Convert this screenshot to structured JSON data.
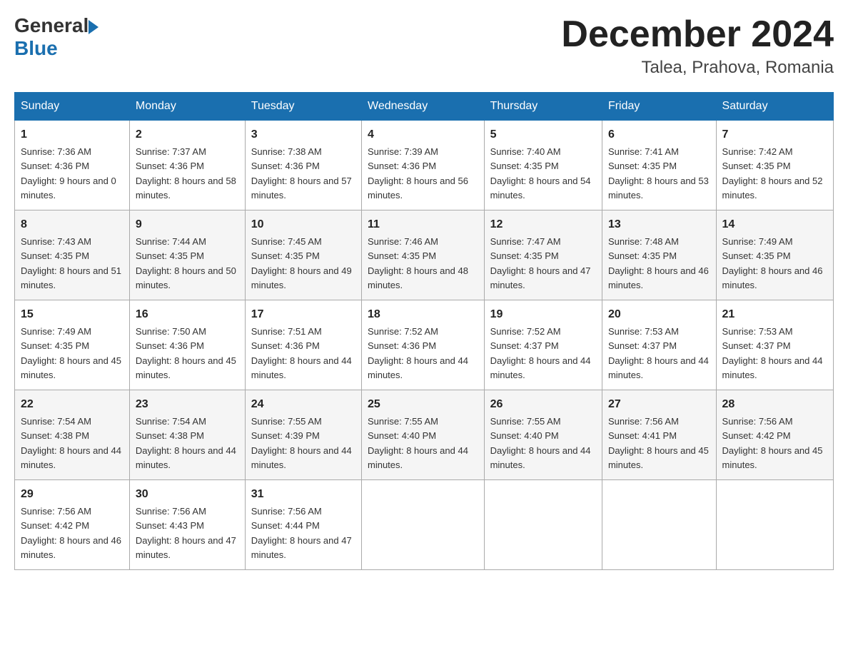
{
  "header": {
    "logo_general": "General",
    "logo_blue": "Blue",
    "month_title": "December 2024",
    "location": "Talea, Prahova, Romania"
  },
  "days_of_week": [
    "Sunday",
    "Monday",
    "Tuesday",
    "Wednesday",
    "Thursday",
    "Friday",
    "Saturday"
  ],
  "weeks": [
    [
      {
        "day": "1",
        "sunrise": "7:36 AM",
        "sunset": "4:36 PM",
        "daylight": "9 hours and 0 minutes."
      },
      {
        "day": "2",
        "sunrise": "7:37 AM",
        "sunset": "4:36 PM",
        "daylight": "8 hours and 58 minutes."
      },
      {
        "day": "3",
        "sunrise": "7:38 AM",
        "sunset": "4:36 PM",
        "daylight": "8 hours and 57 minutes."
      },
      {
        "day": "4",
        "sunrise": "7:39 AM",
        "sunset": "4:36 PM",
        "daylight": "8 hours and 56 minutes."
      },
      {
        "day": "5",
        "sunrise": "7:40 AM",
        "sunset": "4:35 PM",
        "daylight": "8 hours and 54 minutes."
      },
      {
        "day": "6",
        "sunrise": "7:41 AM",
        "sunset": "4:35 PM",
        "daylight": "8 hours and 53 minutes."
      },
      {
        "day": "7",
        "sunrise": "7:42 AM",
        "sunset": "4:35 PM",
        "daylight": "8 hours and 52 minutes."
      }
    ],
    [
      {
        "day": "8",
        "sunrise": "7:43 AM",
        "sunset": "4:35 PM",
        "daylight": "8 hours and 51 minutes."
      },
      {
        "day": "9",
        "sunrise": "7:44 AM",
        "sunset": "4:35 PM",
        "daylight": "8 hours and 50 minutes."
      },
      {
        "day": "10",
        "sunrise": "7:45 AM",
        "sunset": "4:35 PM",
        "daylight": "8 hours and 49 minutes."
      },
      {
        "day": "11",
        "sunrise": "7:46 AM",
        "sunset": "4:35 PM",
        "daylight": "8 hours and 48 minutes."
      },
      {
        "day": "12",
        "sunrise": "7:47 AM",
        "sunset": "4:35 PM",
        "daylight": "8 hours and 47 minutes."
      },
      {
        "day": "13",
        "sunrise": "7:48 AM",
        "sunset": "4:35 PM",
        "daylight": "8 hours and 46 minutes."
      },
      {
        "day": "14",
        "sunrise": "7:49 AM",
        "sunset": "4:35 PM",
        "daylight": "8 hours and 46 minutes."
      }
    ],
    [
      {
        "day": "15",
        "sunrise": "7:49 AM",
        "sunset": "4:35 PM",
        "daylight": "8 hours and 45 minutes."
      },
      {
        "day": "16",
        "sunrise": "7:50 AM",
        "sunset": "4:36 PM",
        "daylight": "8 hours and 45 minutes."
      },
      {
        "day": "17",
        "sunrise": "7:51 AM",
        "sunset": "4:36 PM",
        "daylight": "8 hours and 44 minutes."
      },
      {
        "day": "18",
        "sunrise": "7:52 AM",
        "sunset": "4:36 PM",
        "daylight": "8 hours and 44 minutes."
      },
      {
        "day": "19",
        "sunrise": "7:52 AM",
        "sunset": "4:37 PM",
        "daylight": "8 hours and 44 minutes."
      },
      {
        "day": "20",
        "sunrise": "7:53 AM",
        "sunset": "4:37 PM",
        "daylight": "8 hours and 44 minutes."
      },
      {
        "day": "21",
        "sunrise": "7:53 AM",
        "sunset": "4:37 PM",
        "daylight": "8 hours and 44 minutes."
      }
    ],
    [
      {
        "day": "22",
        "sunrise": "7:54 AM",
        "sunset": "4:38 PM",
        "daylight": "8 hours and 44 minutes."
      },
      {
        "day": "23",
        "sunrise": "7:54 AM",
        "sunset": "4:38 PM",
        "daylight": "8 hours and 44 minutes."
      },
      {
        "day": "24",
        "sunrise": "7:55 AM",
        "sunset": "4:39 PM",
        "daylight": "8 hours and 44 minutes."
      },
      {
        "day": "25",
        "sunrise": "7:55 AM",
        "sunset": "4:40 PM",
        "daylight": "8 hours and 44 minutes."
      },
      {
        "day": "26",
        "sunrise": "7:55 AM",
        "sunset": "4:40 PM",
        "daylight": "8 hours and 44 minutes."
      },
      {
        "day": "27",
        "sunrise": "7:56 AM",
        "sunset": "4:41 PM",
        "daylight": "8 hours and 45 minutes."
      },
      {
        "day": "28",
        "sunrise": "7:56 AM",
        "sunset": "4:42 PM",
        "daylight": "8 hours and 45 minutes."
      }
    ],
    [
      {
        "day": "29",
        "sunrise": "7:56 AM",
        "sunset": "4:42 PM",
        "daylight": "8 hours and 46 minutes."
      },
      {
        "day": "30",
        "sunrise": "7:56 AM",
        "sunset": "4:43 PM",
        "daylight": "8 hours and 47 minutes."
      },
      {
        "day": "31",
        "sunrise": "7:56 AM",
        "sunset": "4:44 PM",
        "daylight": "8 hours and 47 minutes."
      },
      null,
      null,
      null,
      null
    ]
  ]
}
